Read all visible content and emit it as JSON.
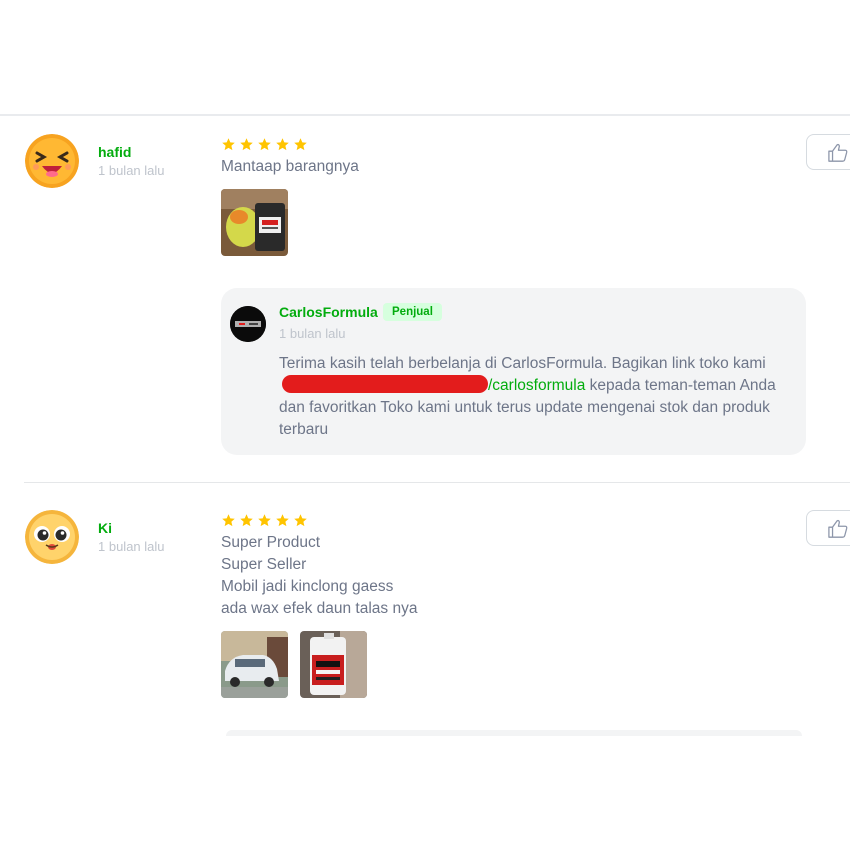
{
  "reviews": [
    {
      "user_name": "hafid",
      "time": "1 bulan lalu",
      "rating": 5,
      "text_lines": [
        "Mantaap barangnya"
      ],
      "seller_reply": {
        "seller_name": "CarlosFormula",
        "badge": "Penjual",
        "time": "1 bulan lalu",
        "text_part1": "Terima kasih telah berbelanja di CarlosFormula. Bagikan link toko kami ",
        "link_text": "/carlosformula",
        "text_part2": " kepada teman-teman Anda dan favoritkan Toko kami untuk terus update mengenai stok dan produk terbaru"
      }
    },
    {
      "user_name": "Ki",
      "time": "1 bulan lalu",
      "rating": 5,
      "text_lines": [
        "Super Product",
        "Super Seller",
        "Mobil jadi kinclong gaess",
        "ada wax efek daun talas nya"
      ]
    }
  ],
  "colors": {
    "accent_green": "#03ac0e",
    "star_yellow": "#ffc400",
    "redaction_red": "#e31c1c",
    "muted_text": "#6d7588",
    "reply_bg": "#f3f4f5"
  },
  "icons": {
    "like": "thumbs-up-icon",
    "star": "star-icon"
  }
}
